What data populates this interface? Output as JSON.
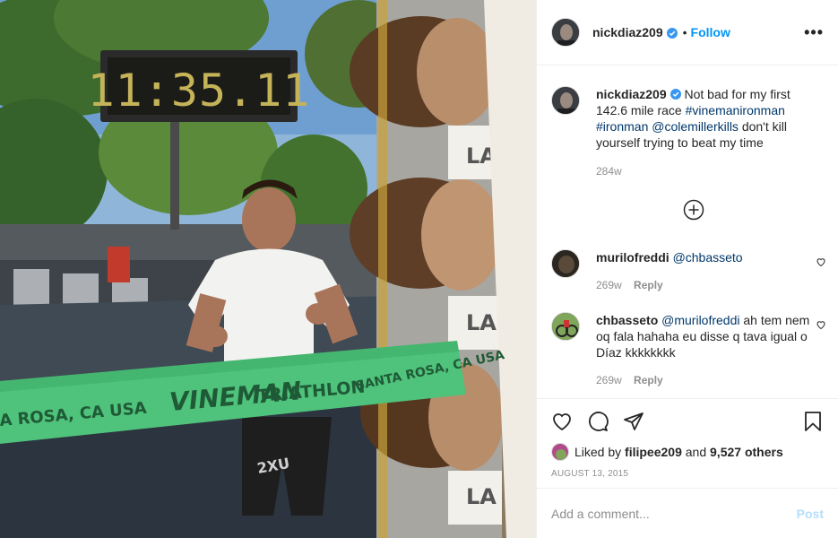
{
  "post": {
    "author": "nickdiaz209",
    "follow_label": "Follow",
    "dot": "•",
    "more_label": "•••",
    "caption": {
      "username": "nickdiaz209",
      "text_1": "Not bad for my first 142.6 mile race",
      "tag_1": "#vinemanironman",
      "tag_2": "#ironman",
      "mention": "@colemillerkills",
      "text_2": "don't kill yourself trying to beat my time",
      "age": "284w"
    },
    "comments": [
      {
        "username": "murilofreddi",
        "mention": "@chbasseto",
        "text": "",
        "age": "269w",
        "reply_label": "Reply"
      },
      {
        "username": "chbasseto",
        "mention": "@murilofreddi",
        "text": "ah tem nem oq fala hahaha eu disse q tava igual o Díaz kkkkkkkk",
        "age": "269w",
        "reply_label": "Reply"
      }
    ],
    "likes": {
      "prefix": "Liked by",
      "user": "filipee209",
      "and": "and",
      "count": "9,527 others"
    },
    "date": "AUGUST 13, 2015",
    "comment_placeholder": "Add a comment...",
    "post_label": "Post"
  },
  "photo": {
    "clock": "11:35.11",
    "banner_left": "A ROSA, CA USA",
    "banner_brand": "VINEMAN",
    "banner_event": "TRIATHLON",
    "banner_right": "SANTA ROSA, CA USA",
    "barrel_label": "LA",
    "shorts_brand": "2XU"
  },
  "colors": {
    "accent": "#0095f6",
    "link": "#00376b",
    "muted": "#8e8e8e",
    "banner_green": "#4fc27b"
  },
  "icons": [
    "verified-icon",
    "more-icon",
    "add-circle-icon",
    "heart-icon",
    "comment-icon",
    "share-icon",
    "bookmark-icon"
  ]
}
